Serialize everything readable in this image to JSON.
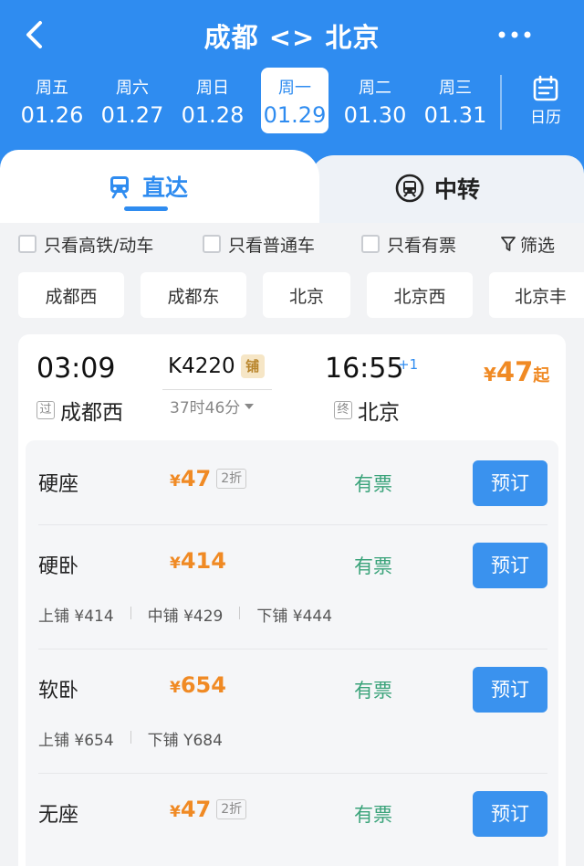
{
  "header": {
    "title": "成都 <> 北京",
    "back_icon": "chevron-left-icon",
    "more_icon": "more-dots-icon",
    "background": "#2f8cf0"
  },
  "dates": [
    {
      "dow": "周五",
      "md": "01.26",
      "active": false
    },
    {
      "dow": "周六",
      "md": "01.27",
      "active": false
    },
    {
      "dow": "周日",
      "md": "01.28",
      "active": false
    },
    {
      "dow": "周一",
      "md": "01.29",
      "active": true
    },
    {
      "dow": "周二",
      "md": "01.30",
      "active": false
    },
    {
      "dow": "周三",
      "md": "01.31",
      "active": false
    }
  ],
  "calendar": {
    "label": "日历",
    "icon": "calendar-icon"
  },
  "tabs": {
    "direct": {
      "label": "直达",
      "icon": "train-icon",
      "active": true
    },
    "transfer": {
      "label": "中转",
      "icon": "transfer-train-icon",
      "active": false
    }
  },
  "filters": {
    "high_speed": "只看高铁/动车",
    "normal": "只看普通车",
    "available": "只看有票",
    "filter_button": "筛选"
  },
  "stations": [
    "成都西",
    "成都东",
    "北京",
    "北京西",
    "北京丰"
  ],
  "train": {
    "dep_time": "03:09",
    "dep_tag": "过",
    "dep_station": "成都西",
    "train_no": "K4220",
    "berth_badge": "铺",
    "duration": "37时46分",
    "arr_time": "16:55",
    "plus_day": "+1",
    "arr_tag": "终",
    "arr_station": "北京",
    "min_price_yen": "¥",
    "min_price": "47",
    "min_price_suffix": "起"
  },
  "seats": [
    {
      "name": "硬座",
      "yen": "¥",
      "price": "47",
      "discount": "2折",
      "status": "有票",
      "button": "预订"
    },
    {
      "name": "硬卧",
      "yen": "¥",
      "price": "414",
      "status": "有票",
      "button": "预订",
      "sub": [
        "上铺 ¥414",
        "中铺 ¥429",
        "下铺 ¥444"
      ]
    },
    {
      "name": "软卧",
      "yen": "¥",
      "price": "654",
      "status": "有票",
      "button": "预订",
      "sub": [
        "上铺 ¥654",
        "下铺 Y684"
      ]
    },
    {
      "name": "无座",
      "yen": "¥",
      "price": "47",
      "discount": "2折",
      "status": "有票",
      "button": "预订"
    }
  ],
  "colors": {
    "accent": "#2f8cf0",
    "price": "#f08a24",
    "available": "#3aa37a",
    "button": "#3a92ee"
  }
}
